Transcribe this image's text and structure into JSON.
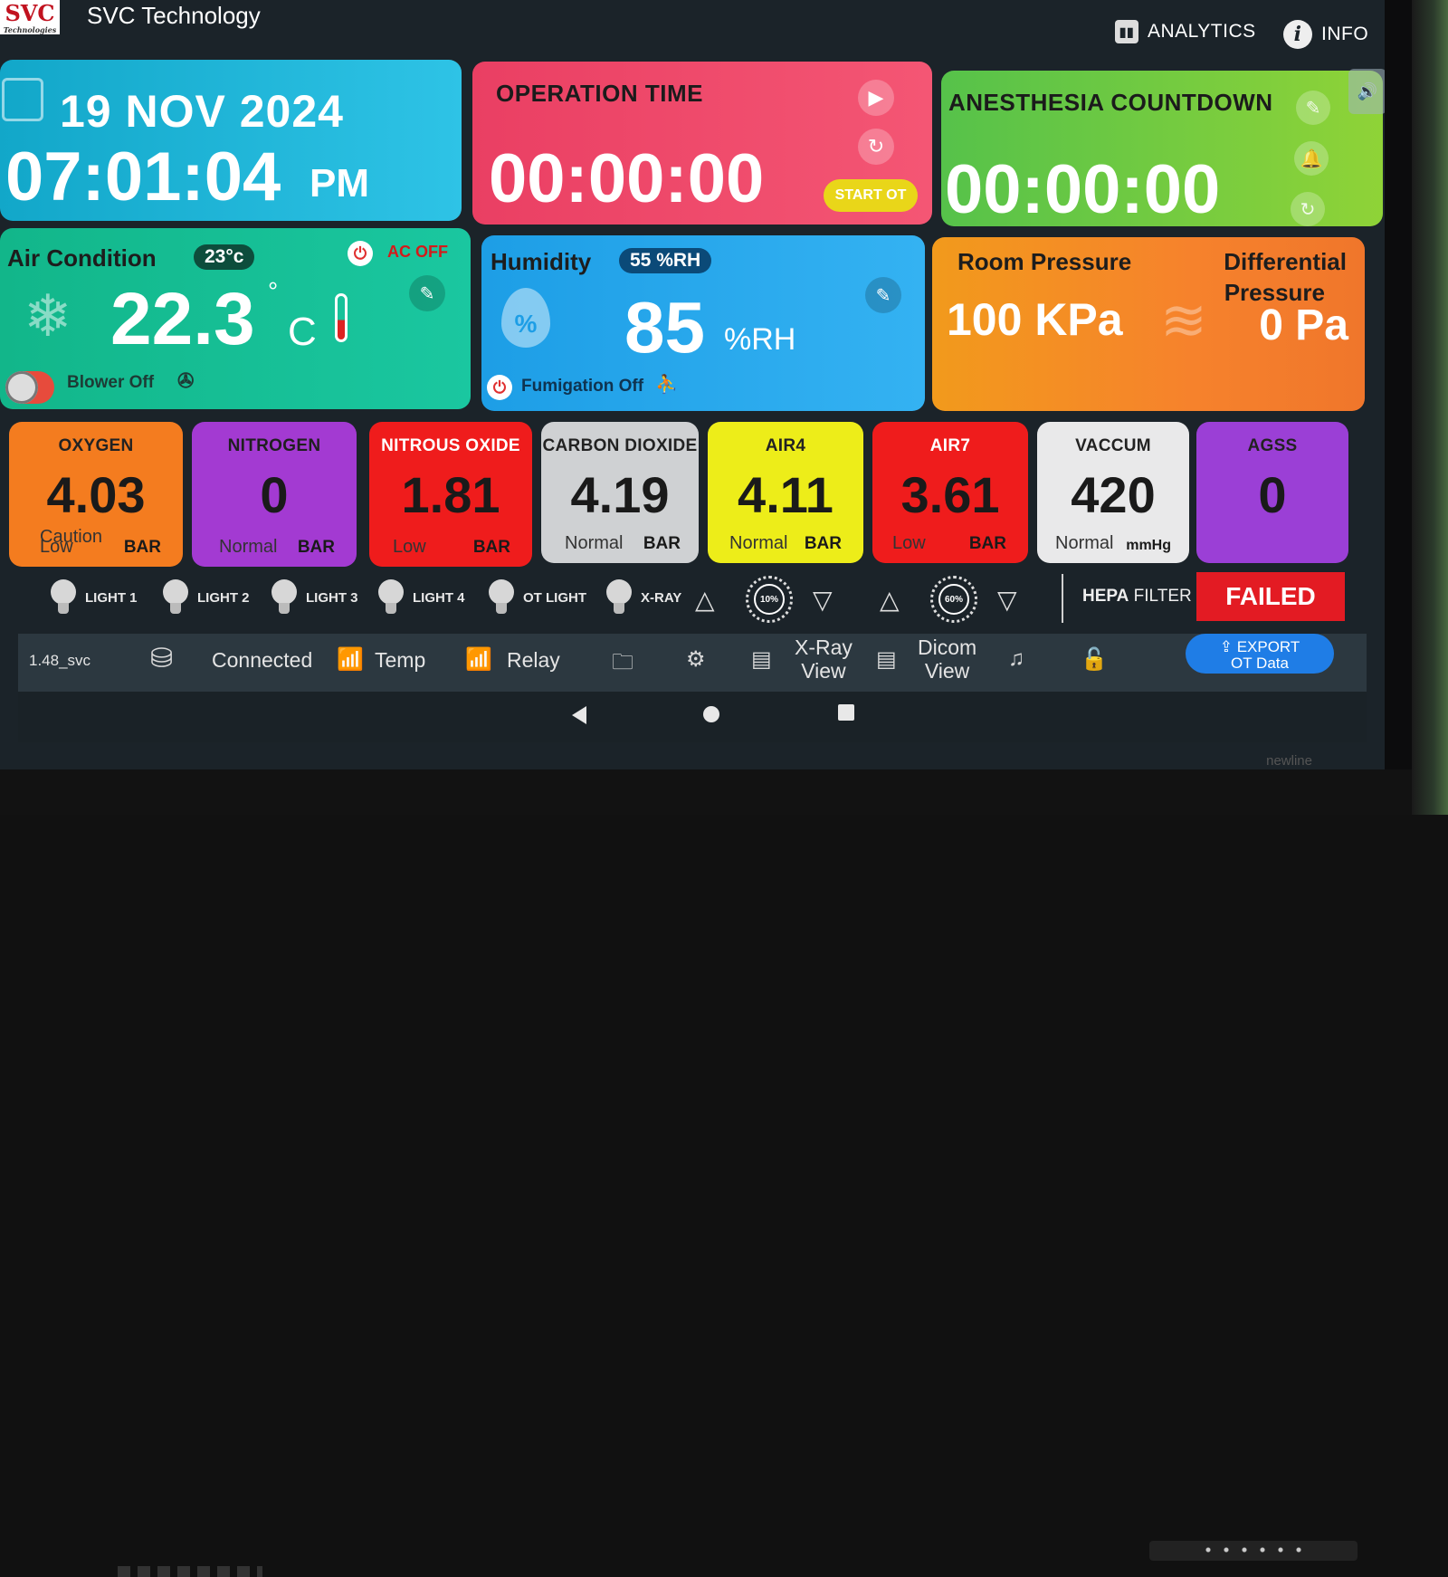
{
  "app": {
    "title": "SVC Technology",
    "logo_text": "SVC",
    "logo_sub": "Technologies"
  },
  "nav": {
    "analytics": "ANALYTICS",
    "info": "INFO"
  },
  "datetime": {
    "date": "19 NOV 2024",
    "time": "07:01:04",
    "ampm": "PM"
  },
  "operation": {
    "title": "OPERATION TIME",
    "timer": "00:00:00",
    "start_label": "START OT"
  },
  "anesthesia": {
    "title": "ANESTHESIA COUNTDOWN",
    "timer": "00:00:00"
  },
  "air_condition": {
    "title": "Air Condition",
    "setpoint": "23°c",
    "ac_status": "AC OFF",
    "temperature": "22.3",
    "degree": "°",
    "unit": "C",
    "blower": "Blower Off"
  },
  "humidity": {
    "title": "Humidity",
    "setpoint": "55 %RH",
    "value": "85",
    "unit": "%RH",
    "fumigation": "Fumigation Off"
  },
  "pressure": {
    "room_title": "Room Pressure",
    "room_value": "100 KPa",
    "diff_title_1": "Differential",
    "diff_title_2": "Pressure",
    "diff_value": "0 Pa"
  },
  "gases": [
    {
      "name": "OXYGEN",
      "value": "4.03",
      "status": "Caution",
      "status2": "Low",
      "unit": "BAR",
      "color": "#f47c1f"
    },
    {
      "name": "NITROGEN",
      "value": "0",
      "status": "Normal",
      "unit": "BAR",
      "color": "#a33ad2"
    },
    {
      "name": "NITROUS OXIDE",
      "value": "1.81",
      "status": "Low",
      "unit": "BAR",
      "color": "#ef1c1c"
    },
    {
      "name": "CARBON DIOXIDE",
      "value": "4.19",
      "status": "Normal",
      "unit": "BAR",
      "color": "#cfd1d3"
    },
    {
      "name": "AIR4",
      "value": "4.11",
      "status": "Normal",
      "unit": "BAR",
      "color": "#eded19"
    },
    {
      "name": "AIR7",
      "value": "3.61",
      "status": "Low",
      "unit": "BAR",
      "color": "#ef1c1c"
    },
    {
      "name": "VACCUM",
      "value": "420",
      "status": "Normal",
      "unit": "mmHg",
      "color": "#e9e9ea"
    },
    {
      "name": "AGSS",
      "value": "0",
      "status": "",
      "unit": "",
      "color": "#9b3fd6"
    }
  ],
  "lights": [
    "LIGHT 1",
    "LIGHT 2",
    "LIGHT 3",
    "LIGHT 4",
    "OT LIGHT",
    "X-RAY"
  ],
  "dials": {
    "dial1": "10%",
    "dial2": "60%"
  },
  "hepa": {
    "label_bold": "HEPA",
    "label": "FILTER",
    "status": "FAILED"
  },
  "statusbar": {
    "version": "1.48_svc",
    "connected": "Connected",
    "temp": "Temp",
    "relay": "Relay",
    "xray_view_1": "X-Ray",
    "xray_view_2": "View",
    "dicom_view_1": "Dicom",
    "dicom_view_2": "View",
    "export_1": "EXPORT",
    "export_2": "OT Data"
  },
  "bezel": {
    "brand": "newline"
  }
}
